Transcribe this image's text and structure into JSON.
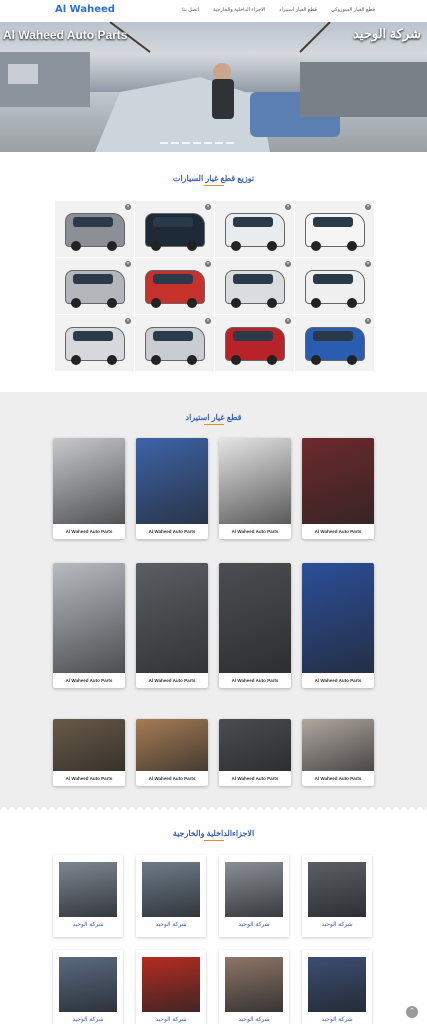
{
  "nav": {
    "brand": "Al Waheed",
    "links": [
      "قطع الغيار السوزوكي",
      "قطع الغيار استيراد",
      "الاجزاء الداخلية والخارجية",
      "اتصل بنا"
    ]
  },
  "hero": {
    "title_en": "Al Waheed Auto Parts",
    "title_ar": "شركة الوحيد",
    "slides": 7
  },
  "section1": {
    "title": "توزيع قطع غيار السيارات",
    "vehicles": [
      {
        "color": "#8c9096"
      },
      {
        "color": "#1e2a38"
      },
      {
        "color": "#e9ecef"
      },
      {
        "color": "#f5f5f5"
      },
      {
        "color": "#b3b6ba"
      },
      {
        "color": "#c7312b"
      },
      {
        "color": "#dadcdf"
      },
      {
        "color": "#f0f0f0"
      },
      {
        "color": "#d6d8db"
      },
      {
        "color": "#c9ccd0"
      },
      {
        "color": "#b8232a"
      },
      {
        "color": "#2a5db0"
      }
    ]
  },
  "section2": {
    "title": "قطع غيار استيراد",
    "caption": "Al Waheed Auto Parts",
    "cards": [
      {
        "bg": "#c7c9cc"
      },
      {
        "bg": "#3d63a8"
      },
      {
        "bg": "#e5e5e5"
      },
      {
        "bg": "#6d2a2d"
      },
      {
        "bg": "#b7bcc2"
      },
      {
        "bg": "#5a5f63"
      },
      {
        "bg": "#4b4e52"
      },
      {
        "bg": "#2b4f9a"
      },
      {
        "bg": "#6a5a48"
      },
      {
        "bg": "#a57c55"
      },
      {
        "bg": "#4a4c50"
      },
      {
        "bg": "#b0a7a0"
      }
    ]
  },
  "section3": {
    "title": "الاجزاءالداخلية والخارجية",
    "caption": "شركة الوحيد",
    "cards": [
      {
        "bg": "#7d8690"
      },
      {
        "bg": "#6e7b88"
      },
      {
        "bg": "#8a8f95"
      },
      {
        "bg": "#5b5f64"
      },
      {
        "bg": "#5a6a80"
      },
      {
        "bg": "#b52c20"
      },
      {
        "bg": "#8d7566"
      },
      {
        "bg": "#3b4e72"
      }
    ]
  },
  "totop_icon": "chevron-up-icon"
}
